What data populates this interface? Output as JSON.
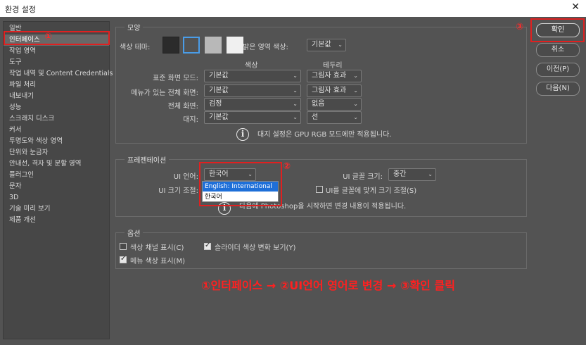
{
  "window": {
    "title": "환경 설정",
    "close_glyph": "✕"
  },
  "sidebar": {
    "items": [
      "일반",
      "인터페이스",
      "작업 영역",
      "도구",
      "작업 내역 및 Content Credentials",
      "파일 처리",
      "내보내기",
      "성능",
      "스크래치 디스크",
      "커서",
      "투명도와 색상 영역",
      "단위와 눈금자",
      "안내선, 격자 및 분할 영역",
      "플러그인",
      "문자",
      "3D",
      "기술 미리 보기",
      "제품 개선"
    ],
    "selected_index": 1
  },
  "appearance": {
    "legend": "모양",
    "color_theme_label": "색상 테마:",
    "highlight_label": "밝은 영역 색상:",
    "highlight_value": "기본값",
    "col_color": "색상",
    "col_border": "테두리",
    "rows": [
      {
        "label": "표준 화면 모드:",
        "color": "기본값",
        "border": "그림자 효과"
      },
      {
        "label": "메뉴가 있는 전체 화면:",
        "color": "기본값",
        "border": "그림자 효과"
      },
      {
        "label": "전체 화면:",
        "color": "검정",
        "border": "없음"
      },
      {
        "label": "대지:",
        "color": "기본값",
        "border": "선"
      }
    ],
    "note": "대지 설정은 GPU RGB 모드에만 적용됩니다.",
    "theme_colors": [
      "#2b2b2b",
      "#535353",
      "#b8b8b8",
      "#f0f0f0"
    ]
  },
  "presentation": {
    "legend": "프레젠테이션",
    "ui_language_label": "UI 언어:",
    "ui_language_value": "한국어",
    "ui_font_size_label": "UI 글꼴 크기:",
    "ui_font_size_value": "중간",
    "ui_scale_label": "UI 크기 조절:",
    "scale_to_font_label": "UI를 글꼴에 맞게 크기 조절(S)",
    "restart_note": "다음에 Photoshop을 시작하면 변경 내용이 적용됩니다.",
    "language_options": [
      "English: International",
      "한국어"
    ]
  },
  "options": {
    "legend": "옵션",
    "items": [
      {
        "label": "색상 채널 표시(C)",
        "checked": false
      },
      {
        "label": "슬라이더 색상 변화 보기(Y)",
        "checked": true
      },
      {
        "label": "메뉴 색상 표시(M)",
        "checked": true
      }
    ]
  },
  "buttons": {
    "ok": "확인",
    "cancel": "취소",
    "prev": "이전(P)",
    "next": "다음(N)"
  },
  "annotations": {
    "marker1": "①",
    "marker2": "②",
    "marker3": "③",
    "instruction": "①인터페이스 → ②UI언어 영어로 변경 → ③확인 클릭",
    "color": "#e02020"
  }
}
